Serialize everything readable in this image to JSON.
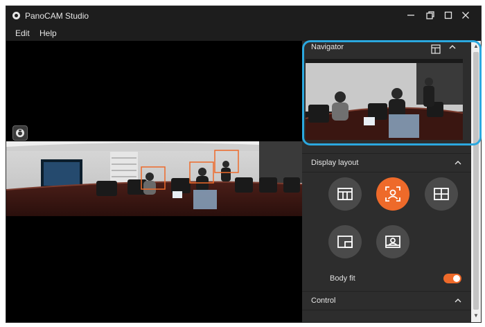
{
  "window": {
    "title": "PanoCAM Studio",
    "controls": [
      "minimize",
      "restore",
      "maximize",
      "close"
    ]
  },
  "menu": {
    "edit": "Edit",
    "help": "Help"
  },
  "panel": {
    "navigator": {
      "label": "Navigator"
    },
    "display_layout": {
      "label": "Display layout",
      "buttons": [
        {
          "icon": "panorama-layout-icon",
          "active": false
        },
        {
          "icon": "speaker-focus-icon",
          "active": true
        },
        {
          "icon": "grid-layout-icon",
          "active": false
        },
        {
          "icon": "picture-in-picture-icon",
          "active": false
        },
        {
          "icon": "presenter-icon",
          "active": false
        }
      ]
    },
    "body_fit": {
      "label": "Body fit",
      "enabled": true
    },
    "control": {
      "label": "Control"
    }
  },
  "colors": {
    "accent": "#ee6a2a",
    "highlight": "#2ba8df",
    "panel_bg": "#2d2d2d",
    "titlebar_bg": "#1d1d1d"
  }
}
